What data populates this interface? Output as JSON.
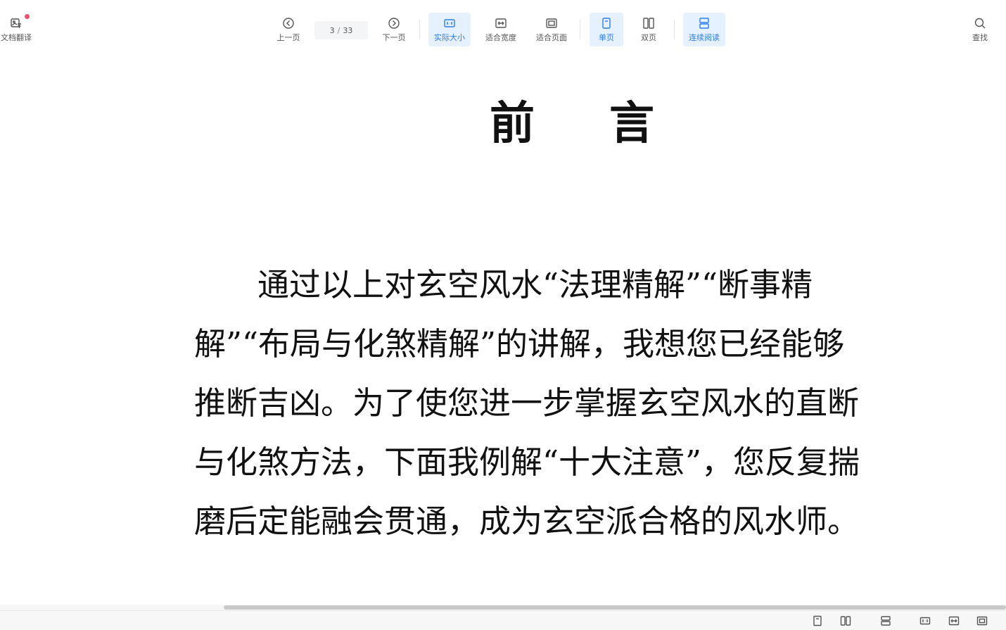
{
  "toolbar": {
    "translate_label": "文档翻译",
    "prev_label": "上一页",
    "current_page": "3",
    "page_sep": "/",
    "total_pages": "33",
    "next_label": "下一页",
    "actual_size_label": "实际大小",
    "fit_width_label": "适合宽度",
    "fit_page_label": "适合页面",
    "single_page_label": "单页",
    "double_page_label": "双页",
    "continuous_label": "连续阅读",
    "search_label": "查找"
  },
  "document": {
    "title_part1": "前",
    "title_part2": "言",
    "paragraph_lines": [
      "　　通过以上对玄空风水“法理精解”“断事精",
      "解”“布局与化煞精解”的讲解，我想您已经能够",
      "推断吉凶。为了使您进一步掌握玄空风水的直断",
      "与化煞方法，下面我例解“十大注意”，您反复揣",
      "磨后定能融会贯通，成为玄空派合格的风水师。"
    ]
  },
  "colors": {
    "accent": "#2b7cf0",
    "active_bg": "#e6f1ff",
    "notification_dot": "#f0506e"
  }
}
